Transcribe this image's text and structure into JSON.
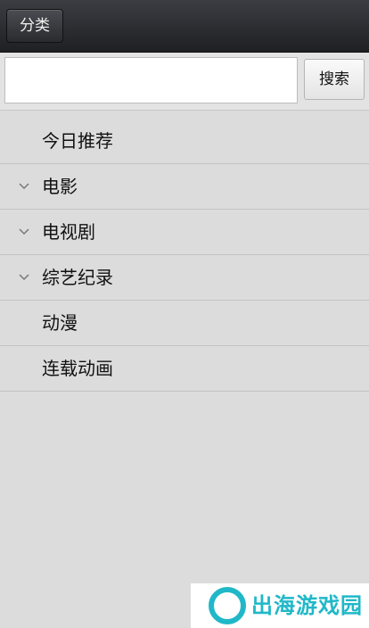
{
  "header": {
    "category_label": "分类"
  },
  "search": {
    "value": "",
    "placeholder": "",
    "button_label": "搜索"
  },
  "menu": {
    "items": [
      {
        "label": "今日推荐",
        "expandable": false
      },
      {
        "label": "电影",
        "expandable": true
      },
      {
        "label": "电视剧",
        "expandable": true
      },
      {
        "label": "综艺纪录",
        "expandable": true
      },
      {
        "label": "动漫",
        "expandable": false
      },
      {
        "label": "连载动画",
        "expandable": false
      }
    ]
  },
  "watermark": {
    "text": "出海游戏园"
  },
  "colors": {
    "header_bg": "#2a2b2f",
    "body_bg": "#dcdcdc",
    "watermark": "#20b8c8",
    "chevron": "#777777"
  }
}
